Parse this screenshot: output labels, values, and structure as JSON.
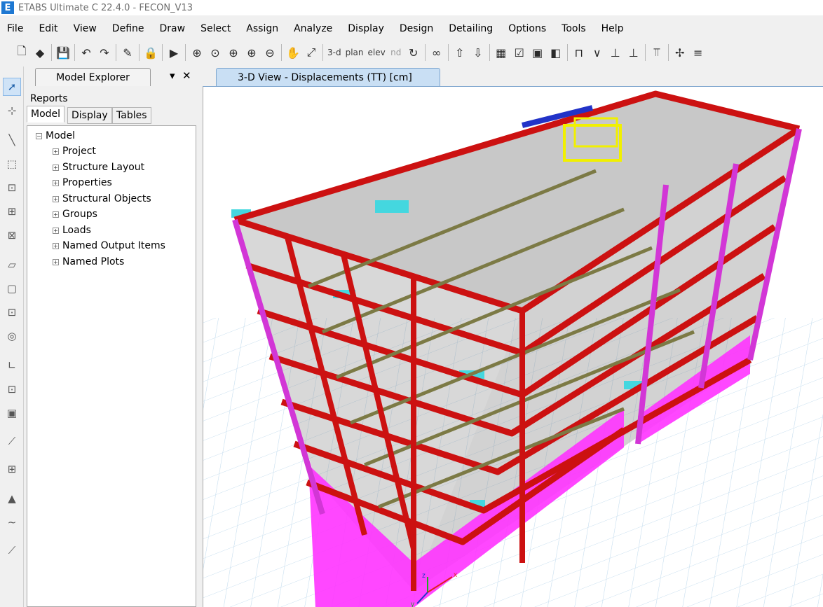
{
  "window": {
    "title": "ETABS Ultimate C 22.4.0 - FECON_V13",
    "icon_letter": "E"
  },
  "menu": [
    "File",
    "Edit",
    "View",
    "Define",
    "Draw",
    "Select",
    "Assign",
    "Analyze",
    "Display",
    "Design",
    "Detailing",
    "Options",
    "Tools",
    "Help"
  ],
  "toolbar": {
    "text_buttons": {
      "three_d": "3-d",
      "plan": "plan",
      "elev": "elev",
      "nd": "nd"
    }
  },
  "explorer": {
    "title": "Model Explorer",
    "dropdown_glyph": "▾",
    "close_glyph": "✕",
    "reports_tab": "Reports",
    "tabs": [
      "Model",
      "Display",
      "Tables"
    ],
    "tree": {
      "root": "Model",
      "children": [
        "Project",
        "Structure Layout",
        "Properties",
        "Structural Objects",
        "Groups",
        "Loads",
        "Named Output Items",
        "Named Plots"
      ]
    }
  },
  "view": {
    "tab_label": "3-D View  - Displacements (TT)  [cm]",
    "axis_labels": {
      "z": "z",
      "x": "x",
      "y": "y"
    }
  },
  "colors": {
    "beam": "#cc1111",
    "column_edge": "#d236d6",
    "wall": "#ff33ff",
    "secondary_beam": "#7c7a45",
    "slab": "#8f8f8f",
    "slab_highlight": "#44d7df",
    "stair_core": "#f1f000",
    "accent_blue": "#2233c8",
    "grid": "#bcd8ec"
  }
}
